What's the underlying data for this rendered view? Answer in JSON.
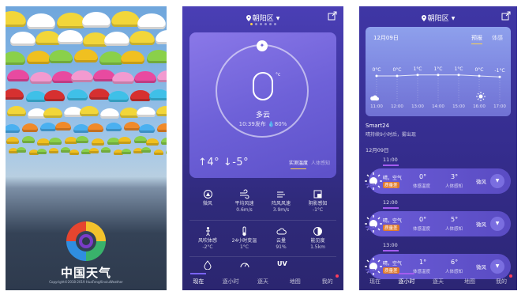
{
  "splash": {
    "brand": "中国天气",
    "copyright": "Copyright©2018-2019 HuaFengXinxiuWeather",
    "umbrella_colors": [
      "#f2d63a",
      "#e23a3a",
      "#3fc0e8",
      "#f08a2a",
      "#e84aa0",
      "#8ad04a",
      "#ffffff",
      "#f4e25a",
      "#d63030",
      "#4ab0f0",
      "#f29ad0",
      "#f0c020"
    ]
  },
  "main": {
    "location": "朝阳区",
    "temperature": "0",
    "degree_symbol": "°c",
    "condition": "多云",
    "published": "10:39发布",
    "humidity": "80%",
    "high": "↑4°",
    "low": "↓-5°",
    "mode_active": "实测温度",
    "mode_inactive": "人体感知",
    "details": [
      {
        "label": "微风",
        "value": "",
        "icon": "wind-compass-icon"
      },
      {
        "label": "平均风速",
        "value": "0.6m/s",
        "icon": "wind-speed-icon"
      },
      {
        "label": "阵风风速",
        "value": "3.9m/s",
        "icon": "gust-icon"
      },
      {
        "label": "阴影感知",
        "value": "-1°C",
        "icon": "shade-icon"
      },
      {
        "label": "风吹体感",
        "value": "-2°C",
        "icon": "person-icon"
      },
      {
        "label": "24小时变温",
        "value": "1°C",
        "icon": "thermometer-icon"
      },
      {
        "label": "云量",
        "value": "91%",
        "icon": "cloud-icon"
      },
      {
        "label": "能见度",
        "value": "1.5km",
        "icon": "visibility-icon"
      }
    ],
    "uv_label": "UV",
    "nav": [
      "现在",
      "逐小时",
      "逐天",
      "地图",
      "我的"
    ]
  },
  "hourly": {
    "location": "朝阳区",
    "date": "12月09日",
    "tab_forecast": "预报",
    "tab_feel": "体感",
    "temps": [
      "0°C",
      "0°C",
      "1°C",
      "1°C",
      "1°C",
      "0°C",
      "-1°C"
    ],
    "times": [
      "11:00",
      "12:00",
      "13:00",
      "14:00",
      "15:00",
      "16:00",
      "17:00"
    ],
    "smart_title": "Smart24",
    "smart_desc": "晴持续9小时后，雾出现",
    "day_label": "12月09日",
    "rows": [
      {
        "time": "11:00",
        "weather": "晴，空气",
        "aqi": "质量差",
        "t1": "0°",
        "s1": "体感温度",
        "t2": "3°",
        "s2": "人体感知",
        "wind": "微风"
      },
      {
        "time": "12:00",
        "weather": "晴，空气",
        "aqi": "质量差",
        "t1": "0°",
        "s1": "体感温度",
        "t2": "5°",
        "s2": "人体感知",
        "wind": "微风"
      },
      {
        "time": "13:00",
        "weather": "晴，空气",
        "aqi": "质量差",
        "t1": "1°",
        "s1": "体感温度",
        "t2": "6°",
        "s2": "人体感知",
        "wind": "微风"
      }
    ],
    "nav": [
      "现在",
      "逐小时",
      "逐天",
      "地图",
      "我的"
    ]
  }
}
